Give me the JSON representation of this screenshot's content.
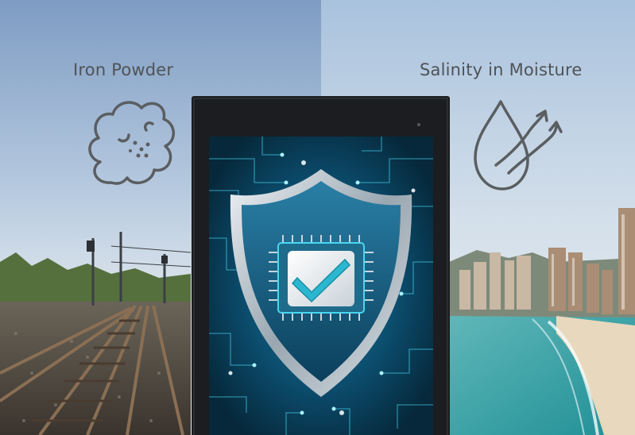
{
  "left_panel": {
    "label": "Iron Powder",
    "icon": "iron-powder-cloud-icon",
    "scene": "railway-tracks"
  },
  "right_panel": {
    "label": "Salinity in Moisture",
    "icon": "water-drop-vapor-icon",
    "scene": "coastal-city-beach"
  },
  "center_display": {
    "screen": "circuit-board-background",
    "emblem": "shield-checkmark-icon"
  },
  "colors": {
    "sky_left": "#7e9cc3",
    "sky_right": "#a9c2dd",
    "caption_text": "#4f5356",
    "icon_stroke": "#5a5e61",
    "circuit": "#0b4a6a",
    "circuit_glow": "#49d6ef",
    "checkmark": "#2bb7cf",
    "bezel": "#1b1d20",
    "sea": "#3aa7a9"
  }
}
